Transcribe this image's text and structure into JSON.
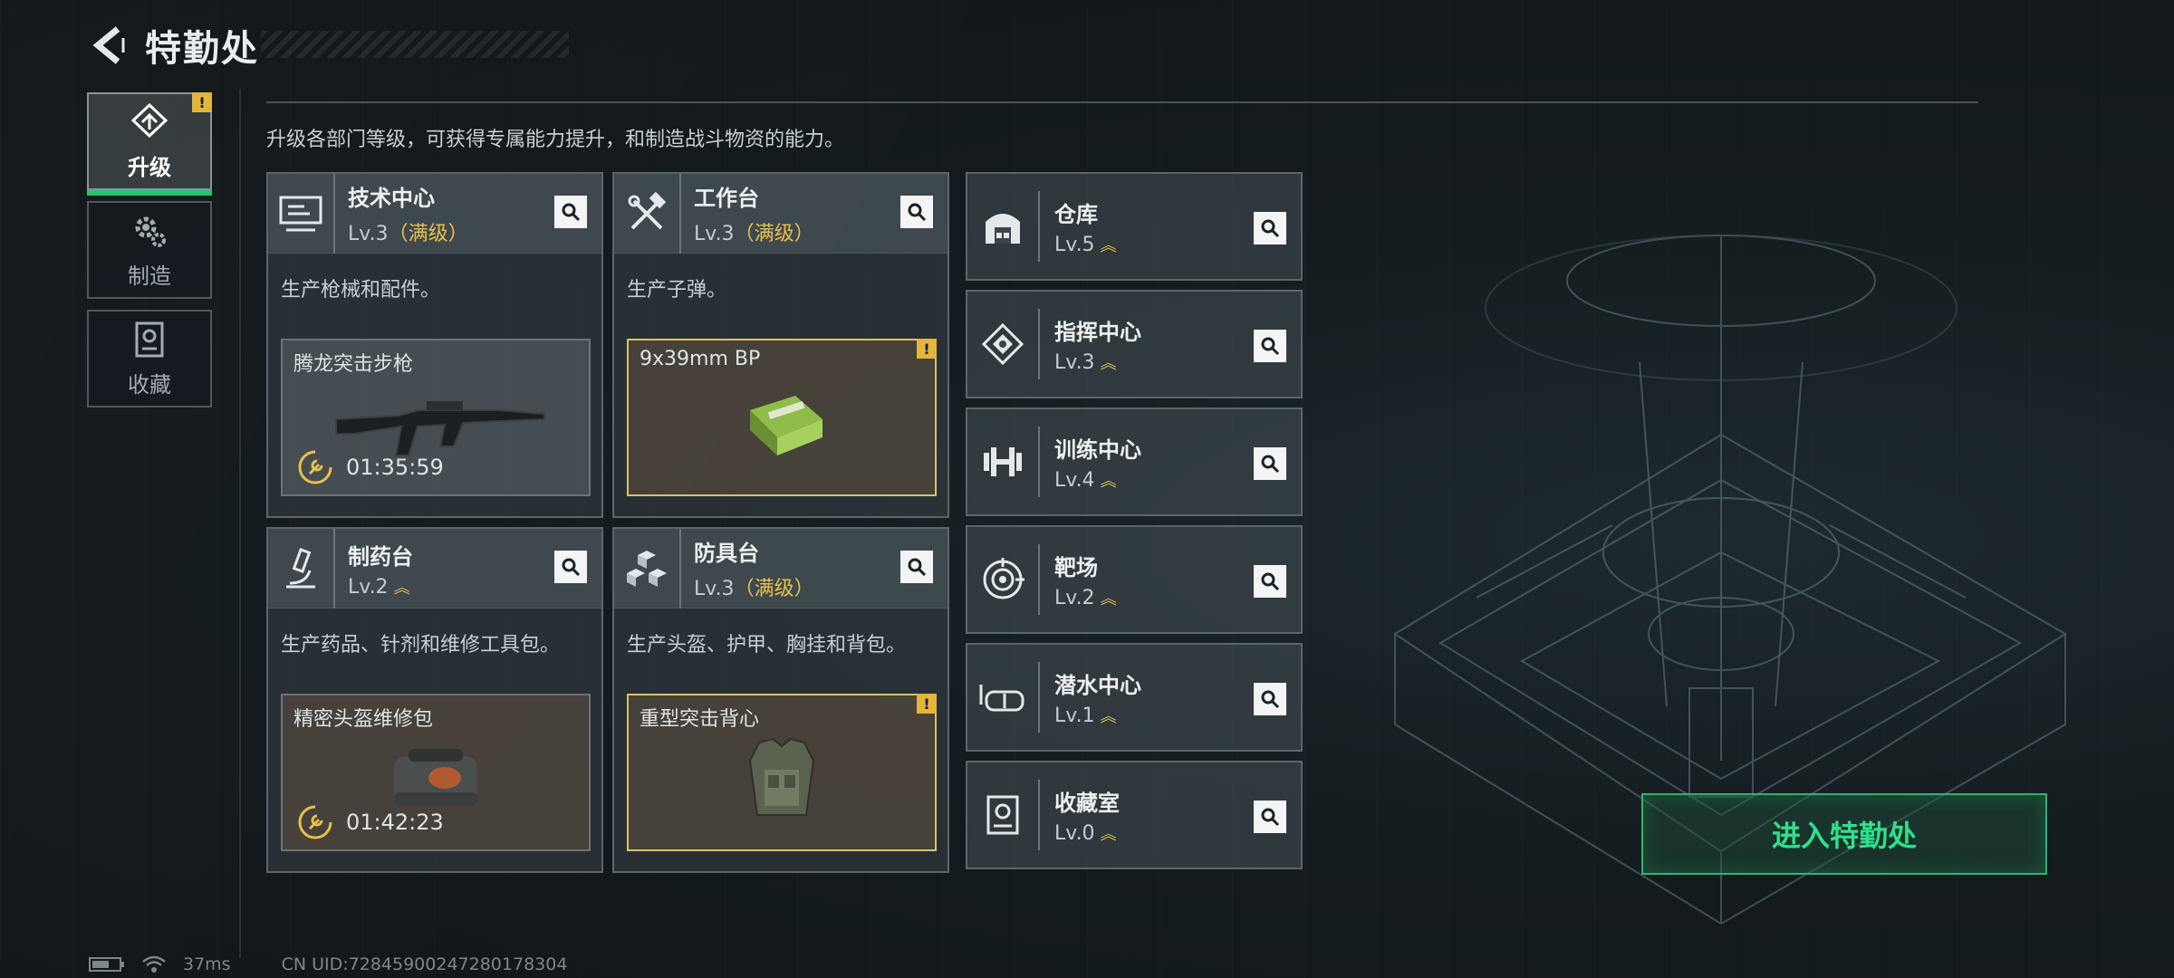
{
  "header": {
    "title": "特勤处"
  },
  "tabs": [
    {
      "label": "升级",
      "icon": "upgrade-icon",
      "active": true,
      "warning": "!"
    },
    {
      "label": "制造",
      "icon": "gear-icon",
      "active": false
    },
    {
      "label": "收藏",
      "icon": "trophy-case-icon",
      "active": false
    }
  ],
  "description": "升级各部门等级，可获得专属能力提升，和制造战斗物资的能力。",
  "cards": [
    {
      "name": "技术中心",
      "level": "Lv.3",
      "max_text": "（满级）",
      "desc": "生产枪械和配件。",
      "product": {
        "name": "腾龙突击步枪",
        "timer": "01:35:59"
      }
    },
    {
      "name": "工作台",
      "level": "Lv.3",
      "max_text": "（满级）",
      "desc": "生产子弹。",
      "product": {
        "name": "9x39mm BP",
        "badge": "!"
      }
    },
    {
      "name": "制药台",
      "level": "Lv.2",
      "desc": "生产药品、针剂和维修工具包。",
      "product": {
        "name": "精密头盔维修包",
        "timer": "01:42:23"
      }
    },
    {
      "name": "防具台",
      "level": "Lv.3",
      "max_text": "（满级）",
      "desc": "生产头盔、护甲、胸挂和背包。",
      "product": {
        "name": "重型突击背心",
        "badge": "!"
      }
    }
  ],
  "rows": [
    {
      "name": "仓库",
      "level": "Lv.5"
    },
    {
      "name": "指挥中心",
      "level": "Lv.3"
    },
    {
      "name": "训练中心",
      "level": "Lv.4"
    },
    {
      "name": "靶场",
      "level": "Lv.2"
    },
    {
      "name": "潜水中心",
      "level": "Lv.1"
    },
    {
      "name": "收藏室",
      "level": "Lv.0"
    }
  ],
  "enter_button": "进入特勤处",
  "status": {
    "ping": "37ms",
    "uid": "CN UID:72845900247280178304"
  },
  "colors": {
    "accent_green": "#2fe08a",
    "max_gold": "#e8c04c",
    "warning": "#e2b63b"
  }
}
